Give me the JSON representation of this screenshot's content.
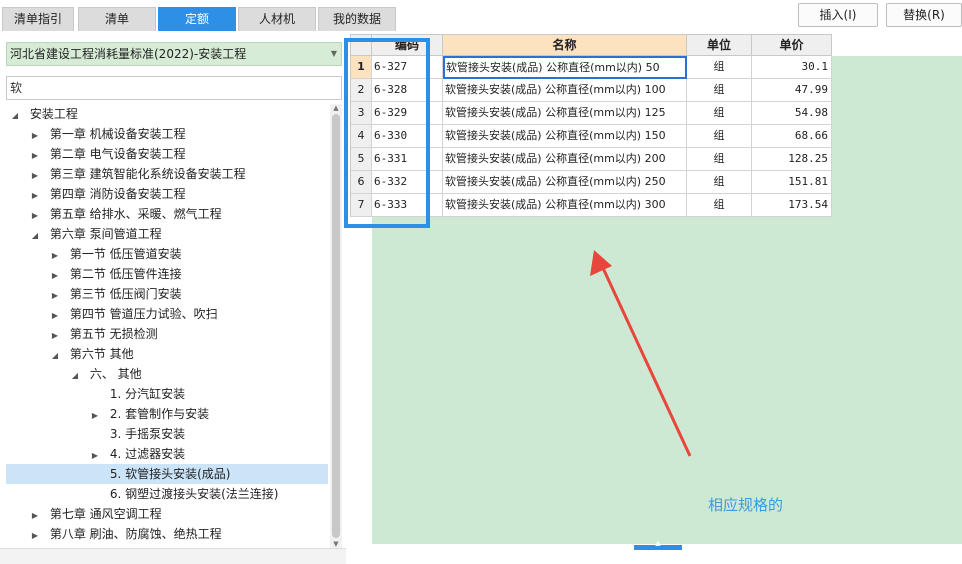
{
  "tabs": [
    {
      "label": "清单指引",
      "active": false
    },
    {
      "label": "清单",
      "active": false
    },
    {
      "label": "定额",
      "active": true
    },
    {
      "label": "人材机",
      "active": false
    },
    {
      "label": "我的数据",
      "active": false
    }
  ],
  "buttons": {
    "insert": "插入(I)",
    "replace": "替换(R)"
  },
  "library_select": {
    "value": "河北省建设工程消耗量标准(2022)-安装工程"
  },
  "search": {
    "value": "软"
  },
  "tree": [
    {
      "label": "安装工程",
      "toggle": "◢"
    },
    {
      "label": "第一章 机械设备安装工程",
      "toggle": "▶"
    },
    {
      "label": "第二章 电气设备安装工程",
      "toggle": "▶"
    },
    {
      "label": "第三章 建筑智能化系统设备安装工程",
      "toggle": "▶"
    },
    {
      "label": "第四章 消防设备安装工程",
      "toggle": "▶"
    },
    {
      "label": "第五章 给排水、采暖、燃气工程",
      "toggle": "▶"
    },
    {
      "label": "第六章 泵间管道工程",
      "toggle": "◢"
    },
    {
      "label": "第一节 低压管道安装",
      "toggle": "▶"
    },
    {
      "label": "第二节 低压管件连接",
      "toggle": "▶"
    },
    {
      "label": "第三节 低压阀门安装",
      "toggle": "▶"
    },
    {
      "label": "第四节 管道压力试验、吹扫",
      "toggle": "▶"
    },
    {
      "label": "第五节 无损检测",
      "toggle": "▶"
    },
    {
      "label": "第六节 其他",
      "toggle": "◢"
    },
    {
      "label": "六、 其他",
      "toggle": "◢"
    },
    {
      "label": "1. 分汽缸安装",
      "toggle": ""
    },
    {
      "label": "2. 套管制作与安装",
      "toggle": "▶"
    },
    {
      "label": "3. 手摇泵安装",
      "toggle": ""
    },
    {
      "label": "4. 过滤器安装",
      "toggle": "▶"
    },
    {
      "label": "5. 软管接头安装(成品)",
      "toggle": ""
    },
    {
      "label": "6. 钢塑过渡接头安装(法兰连接)",
      "toggle": ""
    },
    {
      "label": "第七章 通风空调工程",
      "toggle": "▶"
    },
    {
      "label": "第八章 刷油、防腐蚀、绝热工程",
      "toggle": "▶"
    }
  ],
  "grid": {
    "headers": {
      "rownum": "",
      "code": "编码",
      "name": "名称",
      "unit": "单位",
      "price": "单价"
    },
    "rows": [
      {
        "num": "1",
        "code": "6-327",
        "name": "软管接头安装(成品) 公称直径(mm以内) 50",
        "unit": "组",
        "price": "30.1"
      },
      {
        "num": "2",
        "code": "6-328",
        "name": "软管接头安装(成品) 公称直径(mm以内) 100",
        "unit": "组",
        "price": "47.99"
      },
      {
        "num": "3",
        "code": "6-329",
        "name": "软管接头安装(成品) 公称直径(mm以内) 125",
        "unit": "组",
        "price": "54.98"
      },
      {
        "num": "4",
        "code": "6-330",
        "name": "软管接头安装(成品) 公称直径(mm以内) 150",
        "unit": "组",
        "price": "68.66"
      },
      {
        "num": "5",
        "code": "6-331",
        "name": "软管接头安装(成品) 公称直径(mm以内) 200",
        "unit": "组",
        "price": "128.25"
      },
      {
        "num": "6",
        "code": "6-332",
        "name": "软管接头安装(成品) 公称直径(mm以内) 250",
        "unit": "组",
        "price": "151.81"
      },
      {
        "num": "7",
        "code": "6-333",
        "name": "软管接头安装(成品) 公称直径(mm以内) 300",
        "unit": "组",
        "price": "173.54"
      }
    ]
  },
  "annotation": {
    "note": "相应规格的"
  },
  "colors": {
    "accent": "#2e8fe6",
    "select_bg": "#d6ecd6",
    "grid_bg": "#cde9d3",
    "header_name_bg": "#fde2bf",
    "arrow": "#e8453c"
  },
  "icons": {
    "dropdown": "chevron-down-icon",
    "expand": "triangle-right-icon",
    "collapse": "triangle-down-icon"
  }
}
